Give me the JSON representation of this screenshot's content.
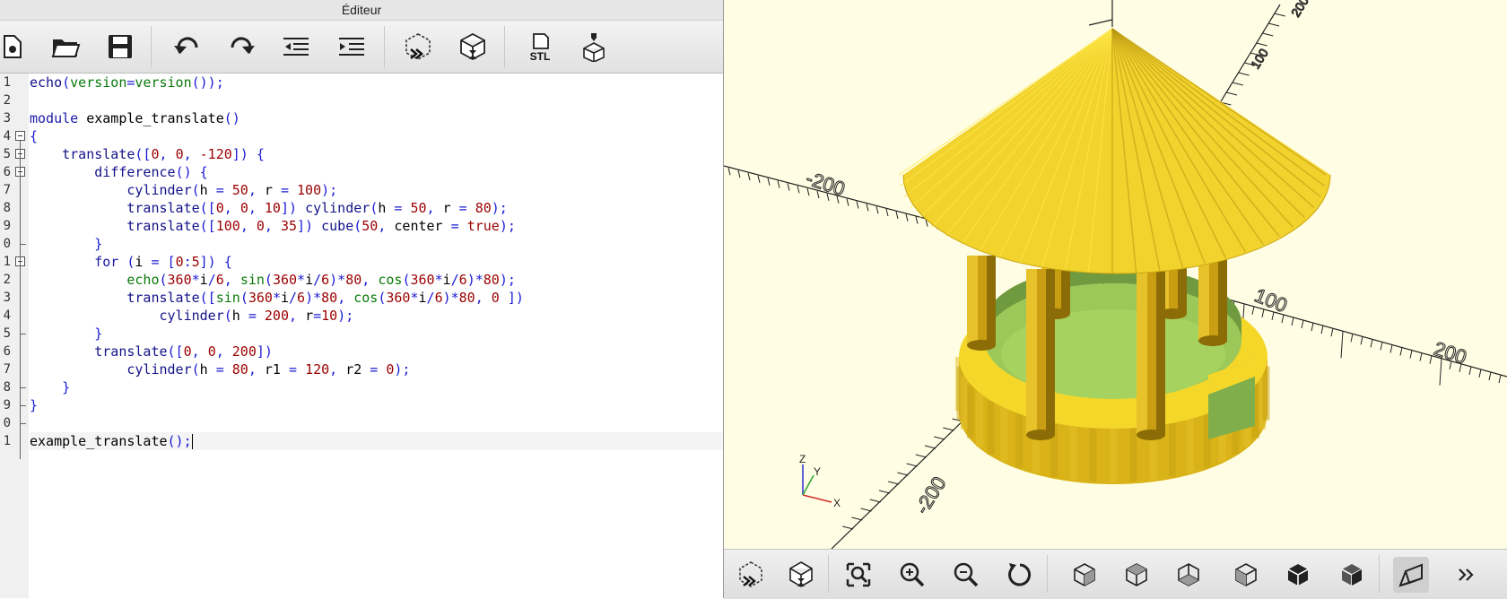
{
  "window": {
    "title": "Éditeur"
  },
  "toolbar": {
    "buttons": [
      {
        "name": "new-file",
        "icon": "new-file-icon"
      },
      {
        "name": "open",
        "icon": "folder-open-icon"
      },
      {
        "name": "save",
        "icon": "save-icon"
      },
      {
        "name": "undo",
        "icon": "undo-icon"
      },
      {
        "name": "redo",
        "icon": "redo-icon"
      },
      {
        "name": "unindent",
        "icon": "unindent-icon"
      },
      {
        "name": "indent",
        "icon": "indent-icon"
      },
      {
        "name": "preview",
        "icon": "preview-icon"
      },
      {
        "name": "render",
        "icon": "render-icon"
      },
      {
        "name": "export-stl",
        "icon": "stl-export-icon",
        "label": "STL"
      },
      {
        "name": "send-to-printer",
        "icon": "print-3d-icon"
      }
    ]
  },
  "editor": {
    "line_numbers": [
      "1",
      "2",
      "3",
      "4",
      "5",
      "6",
      "7",
      "8",
      "9",
      "0",
      "1",
      "2",
      "3",
      "4",
      "5",
      "6",
      "7",
      "8",
      "9",
      "0",
      "1"
    ],
    "current_line": 21,
    "lines": [
      [
        [
          "fn",
          "echo"
        ],
        [
          "p",
          "("
        ],
        [
          "bi",
          "version"
        ],
        [
          "p",
          "="
        ],
        [
          "bi",
          "version"
        ],
        [
          "p",
          "());"
        ]
      ],
      [],
      [
        [
          "kw",
          "module"
        ],
        [
          "t",
          " example_translate"
        ],
        [
          "p",
          "()"
        ]
      ],
      [
        [
          "p",
          "{"
        ]
      ],
      [
        [
          "t",
          "    "
        ],
        [
          "fn",
          "translate"
        ],
        [
          "p",
          "(["
        ],
        [
          "num",
          "0"
        ],
        [
          "p",
          ", "
        ],
        [
          "num",
          "0"
        ],
        [
          "p",
          ", "
        ],
        [
          "num",
          "-120"
        ],
        [
          "p",
          "]) {"
        ]
      ],
      [
        [
          "t",
          "        "
        ],
        [
          "fn",
          "difference"
        ],
        [
          "p",
          "() {"
        ]
      ],
      [
        [
          "t",
          "            "
        ],
        [
          "fn",
          "cylinder"
        ],
        [
          "p",
          "("
        ],
        [
          "t",
          "h"
        ],
        [
          "p",
          " = "
        ],
        [
          "num",
          "50"
        ],
        [
          "p",
          ", "
        ],
        [
          "t",
          "r"
        ],
        [
          "p",
          " = "
        ],
        [
          "num",
          "100"
        ],
        [
          "p",
          ");"
        ]
      ],
      [
        [
          "t",
          "            "
        ],
        [
          "fn",
          "translate"
        ],
        [
          "p",
          "(["
        ],
        [
          "num",
          "0"
        ],
        [
          "p",
          ", "
        ],
        [
          "num",
          "0"
        ],
        [
          "p",
          ", "
        ],
        [
          "num",
          "10"
        ],
        [
          "p",
          "]) "
        ],
        [
          "fn",
          "cylinder"
        ],
        [
          "p",
          "("
        ],
        [
          "t",
          "h"
        ],
        [
          "p",
          " = "
        ],
        [
          "num",
          "50"
        ],
        [
          "p",
          ", "
        ],
        [
          "t",
          "r"
        ],
        [
          "p",
          " = "
        ],
        [
          "num",
          "80"
        ],
        [
          "p",
          ");"
        ]
      ],
      [
        [
          "t",
          "            "
        ],
        [
          "fn",
          "translate"
        ],
        [
          "p",
          "(["
        ],
        [
          "num",
          "100"
        ],
        [
          "p",
          ", "
        ],
        [
          "num",
          "0"
        ],
        [
          "p",
          ", "
        ],
        [
          "num",
          "35"
        ],
        [
          "p",
          "]) "
        ],
        [
          "fn",
          "cube"
        ],
        [
          "p",
          "("
        ],
        [
          "num",
          "50"
        ],
        [
          "p",
          ", "
        ],
        [
          "t",
          "center"
        ],
        [
          "p",
          " = "
        ],
        [
          "num",
          "true"
        ],
        [
          "p",
          ");"
        ]
      ],
      [
        [
          "t",
          "        "
        ],
        [
          "p",
          "}"
        ]
      ],
      [
        [
          "t",
          "        "
        ],
        [
          "kw",
          "for"
        ],
        [
          "p",
          " ("
        ],
        [
          "t",
          "i"
        ],
        [
          "p",
          " = ["
        ],
        [
          "num",
          "0"
        ],
        [
          "p",
          ":"
        ],
        [
          "num",
          "5"
        ],
        [
          "p",
          "]) {"
        ]
      ],
      [
        [
          "t",
          "            "
        ],
        [
          "bi",
          "echo"
        ],
        [
          "p",
          "("
        ],
        [
          "num",
          "360"
        ],
        [
          "p",
          "*"
        ],
        [
          "t",
          "i"
        ],
        [
          "p",
          "/"
        ],
        [
          "num",
          "6"
        ],
        [
          "p",
          ", "
        ],
        [
          "bi",
          "sin"
        ],
        [
          "p",
          "("
        ],
        [
          "num",
          "360"
        ],
        [
          "p",
          "*"
        ],
        [
          "t",
          "i"
        ],
        [
          "p",
          "/"
        ],
        [
          "num",
          "6"
        ],
        [
          "p",
          ")*"
        ],
        [
          "num",
          "80"
        ],
        [
          "p",
          ", "
        ],
        [
          "bi",
          "cos"
        ],
        [
          "p",
          "("
        ],
        [
          "num",
          "360"
        ],
        [
          "p",
          "*"
        ],
        [
          "t",
          "i"
        ],
        [
          "p",
          "/"
        ],
        [
          "num",
          "6"
        ],
        [
          "p",
          ")*"
        ],
        [
          "num",
          "80"
        ],
        [
          "p",
          ");"
        ]
      ],
      [
        [
          "t",
          "            "
        ],
        [
          "fn",
          "translate"
        ],
        [
          "p",
          "(["
        ],
        [
          "bi",
          "sin"
        ],
        [
          "p",
          "("
        ],
        [
          "num",
          "360"
        ],
        [
          "p",
          "*"
        ],
        [
          "t",
          "i"
        ],
        [
          "p",
          "/"
        ],
        [
          "num",
          "6"
        ],
        [
          "p",
          ")*"
        ],
        [
          "num",
          "80"
        ],
        [
          "p",
          ", "
        ],
        [
          "bi",
          "cos"
        ],
        [
          "p",
          "("
        ],
        [
          "num",
          "360"
        ],
        [
          "p",
          "*"
        ],
        [
          "t",
          "i"
        ],
        [
          "p",
          "/"
        ],
        [
          "num",
          "6"
        ],
        [
          "p",
          ")*"
        ],
        [
          "num",
          "80"
        ],
        [
          "p",
          ", "
        ],
        [
          "num",
          "0"
        ],
        [
          "p",
          " ])"
        ]
      ],
      [
        [
          "t",
          "                "
        ],
        [
          "fn",
          "cylinder"
        ],
        [
          "p",
          "("
        ],
        [
          "t",
          "h"
        ],
        [
          "p",
          " = "
        ],
        [
          "num",
          "200"
        ],
        [
          "p",
          ", "
        ],
        [
          "t",
          "r"
        ],
        [
          "p",
          "="
        ],
        [
          "num",
          "10"
        ],
        [
          "p",
          ");"
        ]
      ],
      [
        [
          "t",
          "        "
        ],
        [
          "p",
          "}"
        ]
      ],
      [
        [
          "t",
          "        "
        ],
        [
          "fn",
          "translate"
        ],
        [
          "p",
          "(["
        ],
        [
          "num",
          "0"
        ],
        [
          "p",
          ", "
        ],
        [
          "num",
          "0"
        ],
        [
          "p",
          ", "
        ],
        [
          "num",
          "200"
        ],
        [
          "p",
          "])"
        ]
      ],
      [
        [
          "t",
          "            "
        ],
        [
          "fn",
          "cylinder"
        ],
        [
          "p",
          "("
        ],
        [
          "t",
          "h"
        ],
        [
          "p",
          " = "
        ],
        [
          "num",
          "80"
        ],
        [
          "p",
          ", "
        ],
        [
          "t",
          "r1"
        ],
        [
          "p",
          " = "
        ],
        [
          "num",
          "120"
        ],
        [
          "p",
          ", "
        ],
        [
          "t",
          "r2"
        ],
        [
          "p",
          " = "
        ],
        [
          "num",
          "0"
        ],
        [
          "p",
          ");"
        ]
      ],
      [
        [
          "t",
          "    "
        ],
        [
          "p",
          "}"
        ]
      ],
      [
        [
          "p",
          "}"
        ]
      ],
      [],
      [
        [
          "t",
          "example_translate"
        ],
        [
          "p",
          "();"
        ]
      ]
    ]
  },
  "viewport": {
    "colors": {
      "background": "#fffee4",
      "model_face": "#f5d72a",
      "cut_face": "#9bc95a",
      "axes": "#222222"
    },
    "axis_labels": [
      "200",
      "100",
      "-200",
      "-200",
      "100",
      "100",
      "200"
    ],
    "axis_label_rows": [
      {
        "text": "-200",
        "rot": 15
      },
      {
        "text": "100",
        "rot": 20
      },
      {
        "text": "200",
        "rot": 18
      }
    ],
    "mini_axes": {
      "x": "X",
      "y": "Y",
      "z": "Z"
    }
  },
  "view_toolbar": {
    "buttons": [
      {
        "name": "preview",
        "icon": "preview-icon"
      },
      {
        "name": "render",
        "icon": "render-icon"
      },
      {
        "name": "view-all",
        "icon": "zoom-fit-icon"
      },
      {
        "name": "zoom-in",
        "icon": "zoom-in-icon"
      },
      {
        "name": "zoom-out",
        "icon": "zoom-out-icon"
      },
      {
        "name": "reset-view",
        "icon": "reset-view-icon"
      },
      {
        "name": "view-right",
        "icon": "view-right-icon"
      },
      {
        "name": "view-top",
        "icon": "view-top-icon"
      },
      {
        "name": "view-bottom",
        "icon": "view-bottom-icon"
      },
      {
        "name": "view-left",
        "icon": "view-left-icon"
      },
      {
        "name": "view-front",
        "icon": "view-front-icon"
      },
      {
        "name": "view-back",
        "icon": "view-back-icon"
      },
      {
        "name": "perspective",
        "icon": "perspective-icon"
      },
      {
        "name": "more",
        "icon": "more-chevron-icon"
      }
    ]
  }
}
